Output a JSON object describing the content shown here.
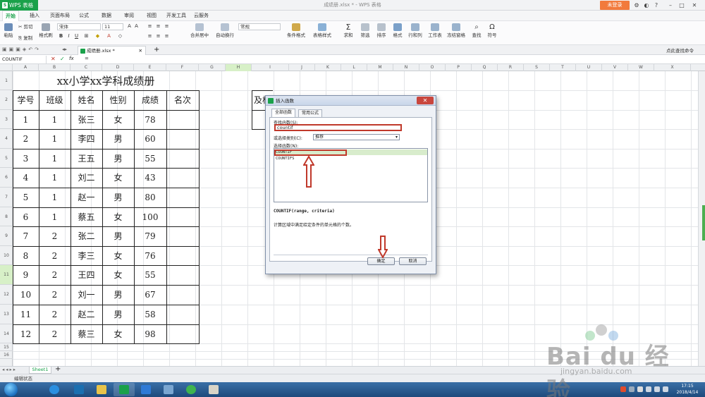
{
  "titlebar": {
    "app_name": "WPS 表格",
    "doc_title": "成绩册.xlsx * - WPS 表格",
    "login": "未登录"
  },
  "menu": [
    "开始",
    "插入",
    "页面布局",
    "公式",
    "数据",
    "审阅",
    "视图",
    "开发工具",
    "云服务"
  ],
  "ribbon": {
    "paste": "粘贴",
    "cut": "剪切",
    "copy": "复制",
    "format_painter": "格式刷",
    "font": "宋体",
    "size": "11",
    "number_format": "常规",
    "merge": "合并居中",
    "wrap": "自动换行",
    "conditional": "条件格式",
    "table_style": "表格样式",
    "sum": "求和",
    "filter": "筛选",
    "sort": "排序",
    "format": "格式",
    "rows_cols": "行和列",
    "sheet": "工作表",
    "freeze": "冻结窗格",
    "find": "查找",
    "symbol": "符号",
    "search_hint": "点此查找命令"
  },
  "doc_tab": "成绩册.xlsx *",
  "formula_bar": {
    "name_box": "COUNTIF",
    "fx": "fx",
    "content": "="
  },
  "columns": [
    "A",
    "B",
    "C",
    "D",
    "E",
    "F",
    "G",
    "H",
    "I",
    "J",
    "K",
    "L",
    "M",
    "N",
    "O",
    "P",
    "Q",
    "R",
    "S",
    "T",
    "U",
    "V",
    "W",
    "X"
  ],
  "rows": [
    "1",
    "2",
    "3",
    "4",
    "5",
    "6",
    "7",
    "8",
    "9",
    "10",
    "11",
    "12",
    "13",
    "14",
    "15",
    "16"
  ],
  "sheet": {
    "title": "xx小学xx学科成绩册",
    "headers": [
      "学号",
      "班级",
      "姓名",
      "性别",
      "成绩",
      "名次"
    ],
    "records": [
      [
        "1",
        "1",
        "张三",
        "女",
        "78",
        ""
      ],
      [
        "2",
        "1",
        "李四",
        "男",
        "60",
        ""
      ],
      [
        "3",
        "1",
        "王五",
        "男",
        "55",
        ""
      ],
      [
        "4",
        "1",
        "刘二",
        "女",
        "43",
        ""
      ],
      [
        "5",
        "1",
        "赵一",
        "男",
        "80",
        ""
      ],
      [
        "6",
        "1",
        "蔡五",
        "女",
        "100",
        ""
      ],
      [
        "7",
        "2",
        "张二",
        "男",
        "79",
        ""
      ],
      [
        "8",
        "2",
        "李三",
        "女",
        "76",
        ""
      ],
      [
        "9",
        "2",
        "王四",
        "女",
        "55",
        ""
      ],
      [
        "10",
        "2",
        "刘一",
        "男",
        "67",
        ""
      ],
      [
        "11",
        "2",
        "赵二",
        "男",
        "58",
        ""
      ],
      [
        "12",
        "2",
        "蔡三",
        "女",
        "98",
        ""
      ]
    ],
    "partial_cell": "及格"
  },
  "dialog": {
    "title": "插入函数",
    "close": "✕",
    "tabs": [
      "全部函数",
      "常用公式"
    ],
    "search_label": "查找函数(S):",
    "search_value": "countif",
    "category_label": "或选择类别(C):",
    "category_value": "推荐",
    "select_label": "选择函数(N):",
    "functions": [
      "COUNTIF",
      "COUNTIFS"
    ],
    "signature": "COUNTIF(range, criteria)",
    "description": "计算区域中满足给定条件的单元格的个数。",
    "ok": "确定",
    "cancel": "取消"
  },
  "sheet_tabs": [
    "Sheet1"
  ],
  "status": "编辑状态",
  "clock": {
    "time": "17:15",
    "date": "2018/4/14"
  },
  "watermark": {
    "brand": "Bai du 经验",
    "url": "jingyan.baidu.com"
  },
  "colors": {
    "wps_green": "#1aa14a",
    "highlight_red": "#c0392b",
    "login_orange": "#f27a3c"
  }
}
